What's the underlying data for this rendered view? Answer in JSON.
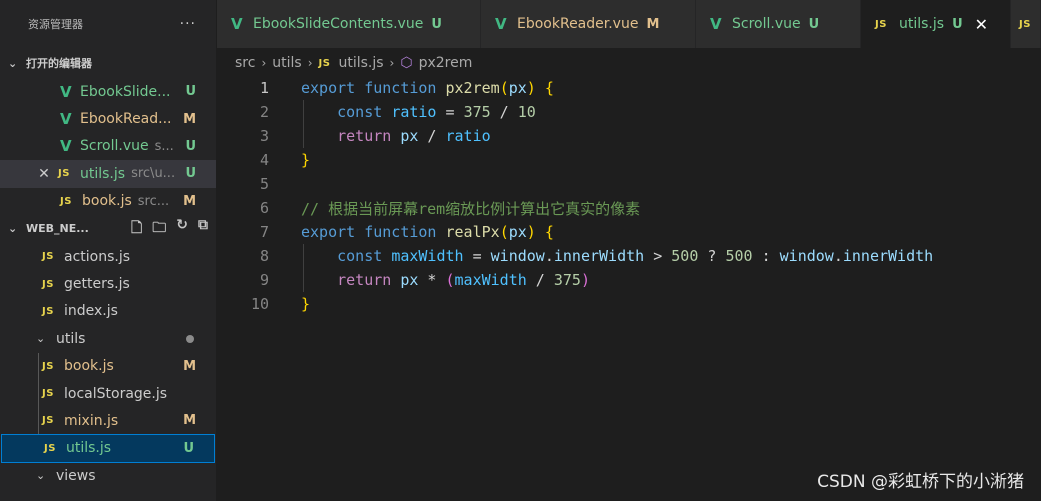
{
  "sidebar": {
    "title": "资源管理器",
    "more": "···",
    "open_editors_header": "打开的编辑器",
    "open_editors": [
      {
        "name": "EbookSlide...",
        "badge": "U"
      },
      {
        "name": "EbookRead...",
        "badge": "M"
      },
      {
        "name": "Scroll.vue",
        "sub": "s...",
        "badge": "U"
      },
      {
        "name": "utils.js",
        "sub": "src\\u...",
        "badge": "U"
      },
      {
        "name": "book.js",
        "sub": "src...",
        "badge": "M"
      }
    ],
    "workspace_header": "WEB_NE...",
    "files": [
      {
        "name": "actions.js"
      },
      {
        "name": "getters.js"
      },
      {
        "name": "index.js"
      },
      {
        "name": "utils"
      },
      {
        "name": "book.js",
        "badge": "M"
      },
      {
        "name": "localStorage.js"
      },
      {
        "name": "mixin.js",
        "badge": "M"
      },
      {
        "name": "utils.js",
        "badge": "U"
      },
      {
        "name": "views"
      }
    ]
  },
  "tabs": [
    {
      "name": "EbookSlideContents.vue",
      "badge": "U"
    },
    {
      "name": "EbookReader.vue",
      "badge": "M"
    },
    {
      "name": "Scroll.vue",
      "badge": "U"
    },
    {
      "name": "utils.js",
      "badge": "U",
      "close": "✕"
    },
    {
      "name": "JS"
    }
  ],
  "breadcrumb": {
    "p1": "src",
    "p2": "utils",
    "p3": "utils.js",
    "p4": "px2rem",
    "js": "JS"
  },
  "code": {
    "line_numbers": [
      "1",
      "2",
      "3",
      "4",
      "5",
      "6",
      "7",
      "8",
      "9",
      "10"
    ],
    "tokens": {
      "export": "export",
      "function": "function",
      "px2rem": "px2rem",
      "px": "px",
      "const": "const",
      "ratio": "ratio",
      "n375": "375",
      "n10": "10",
      "return": "return",
      "comment": "// 根据当前屏幕rem缩放比例计算出它真实的像素",
      "realPx": "realPx",
      "maxWidth": "maxWidth",
      "window": "window",
      "innerWidth": "innerWidth",
      "n500": "500"
    }
  },
  "watermark": "CSDN @彩虹桥下的小淅猪"
}
